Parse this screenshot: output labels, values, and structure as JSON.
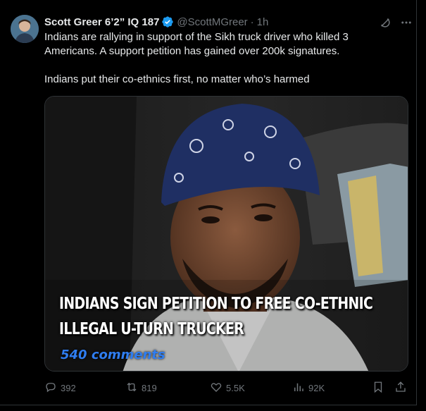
{
  "author": {
    "name": "Scott Greer 6’2” IQ 187",
    "handle": "@ScottMGreer",
    "separator": "·",
    "time": "1h"
  },
  "post": {
    "paragraphs": [
      "Indians are rallying in support of the Sikh truck driver who killed 3 Americans. A support petition has gained over 200k signatures.",
      "Indians put their co-ethnics first, no matter who’s harmed"
    ]
  },
  "media": {
    "caption_line1": "INDIANS SIGN PETITION TO FREE CO-ETHNIC",
    "caption_line2": "ILLEGAL U-TURN TRUCKER",
    "comments_overlay": "540 comments"
  },
  "actions": {
    "replies": "392",
    "reposts": "819",
    "likes": "5.5K",
    "views": "92K"
  },
  "icons": {
    "verified": "verified-badge-icon",
    "grok": "grok-icon",
    "more": "more-icon",
    "reply": "reply-icon",
    "repost": "repost-icon",
    "like": "like-icon",
    "views": "views-icon",
    "bookmark": "bookmark-icon",
    "share": "share-icon"
  },
  "colors": {
    "background": "#000000",
    "text": "#e7e9ea",
    "muted": "#71767b",
    "verified": "#1d9bf0",
    "comments_overlay": "#2f7df0"
  }
}
